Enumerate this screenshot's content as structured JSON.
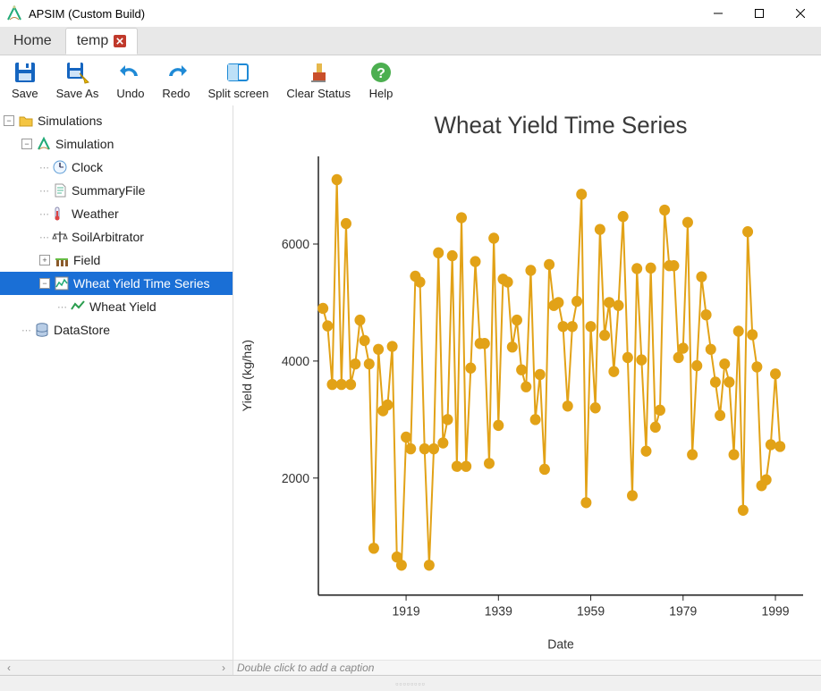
{
  "window": {
    "title": "APSIM (Custom Build)"
  },
  "tabs": {
    "home": "Home",
    "file": "temp"
  },
  "toolbar": {
    "save": "Save",
    "saveas": "Save As",
    "undo": "Undo",
    "redo": "Redo",
    "split": "Split screen",
    "clear": "Clear Status",
    "help": "Help"
  },
  "tree": {
    "root": "Simulations",
    "sim": "Simulation",
    "clock": "Clock",
    "summary": "SummaryFile",
    "weather": "Weather",
    "soil": "SoilArbitrator",
    "field": "Field",
    "series": "Wheat Yield Time Series",
    "yield": "Wheat Yield",
    "datastore": "DataStore"
  },
  "chart": {
    "title": "Wheat Yield Time Series",
    "xlabel": "Date",
    "ylabel": "Yield (kg/ha)",
    "caption_placeholder": "Double click to add a caption"
  },
  "chart_data": {
    "type": "line",
    "title": "Wheat Yield Time Series",
    "xlabel": "Date",
    "ylabel": "Yield (kg/ha)",
    "xlim": [
      1900,
      2005
    ],
    "ylim": [
      0,
      7500
    ],
    "xticks": [
      1919,
      1939,
      1959,
      1979,
      1999
    ],
    "yticks": [
      2000,
      4000,
      6000
    ],
    "color": "#e2a217",
    "series": [
      {
        "name": "Wheat Yield",
        "x": [
          1901,
          1902,
          1903,
          1904,
          1905,
          1906,
          1907,
          1908,
          1909,
          1910,
          1911,
          1912,
          1913,
          1914,
          1915,
          1916,
          1917,
          1918,
          1919,
          1920,
          1921,
          1922,
          1923,
          1924,
          1925,
          1926,
          1927,
          1928,
          1929,
          1930,
          1931,
          1932,
          1933,
          1934,
          1935,
          1936,
          1937,
          1938,
          1939,
          1940,
          1941,
          1942,
          1943,
          1944,
          1945,
          1946,
          1947,
          1948,
          1949,
          1950,
          1951,
          1952,
          1953,
          1954,
          1955,
          1956,
          1957,
          1958,
          1959,
          1960,
          1961,
          1962,
          1963,
          1964,
          1965,
          1966,
          1967,
          1968,
          1969,
          1970,
          1971,
          1972,
          1973,
          1974,
          1975,
          1976,
          1977,
          1978,
          1979,
          1980,
          1981,
          1982,
          1983,
          1984,
          1985,
          1986,
          1987,
          1988,
          1989,
          1990,
          1991,
          1992,
          1993,
          1994,
          1995,
          1996,
          1997,
          1998,
          1999,
          2000
        ],
        "values": [
          4900,
          4600,
          3600,
          7100,
          3600,
          6350,
          3600,
          3950,
          4700,
          4350,
          3950,
          800,
          4200,
          3150,
          3250,
          4250,
          650,
          510,
          2700,
          2500,
          5450,
          5350,
          2500,
          510,
          2500,
          5850,
          2600,
          3000,
          5800,
          2200,
          6450,
          2200,
          3880,
          5700,
          4300,
          4300,
          2250,
          6100,
          2900,
          5400,
          5350,
          4240,
          4700,
          3850,
          3560,
          5550,
          3000,
          3770,
          2150,
          5650,
          4950,
          5000,
          4590,
          3230,
          4590,
          5020,
          6850,
          1580,
          4590,
          3200,
          6250,
          4440,
          5000,
          3820,
          4950,
          6470,
          4060,
          1700,
          5580,
          4020,
          2460,
          5590,
          2870,
          3160,
          6580,
          5630,
          5630,
          4060,
          4220,
          6370,
          2400,
          3920,
          5440,
          4790,
          4200,
          3640,
          3070,
          3950,
          3640,
          2400,
          4510,
          1450,
          6210,
          4450,
          3900,
          1870,
          1970,
          2570,
          3780,
          2540
        ]
      }
    ]
  }
}
